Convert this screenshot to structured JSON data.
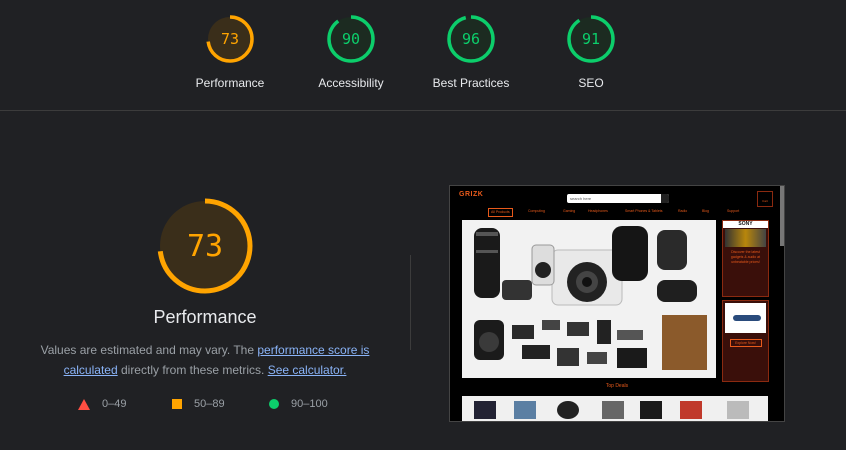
{
  "gauges": [
    {
      "label": "Performance",
      "score": "73",
      "value": 73,
      "color": "#ffa400",
      "bg": "#3a2e1a"
    },
    {
      "label": "Accessibility",
      "score": "90",
      "value": 90,
      "color": "#0cce6b",
      "bg": "#1c2b21"
    },
    {
      "label": "Best Practices",
      "score": "96",
      "value": 96,
      "color": "#0cce6b",
      "bg": "#1c2b21"
    },
    {
      "label": "SEO",
      "score": "91",
      "value": 91,
      "color": "#0cce6b",
      "bg": "#1c2b21"
    }
  ],
  "main": {
    "score": "73",
    "value": 73,
    "title": "Performance",
    "desc_part1": "Values are estimated and may vary. The ",
    "desc_link1": "performance score is calculated",
    "desc_part2": " directly from these metrics. ",
    "desc_link2": "See calculator."
  },
  "legend": {
    "fail": "0–49",
    "average": "50–89",
    "pass": "90–100"
  },
  "thumbnail": {
    "logo": "GRIZK",
    "search_placeholder": "search here",
    "cart": "Cart",
    "categories": [
      "All Products",
      "Computing",
      "Gaming",
      "Headphones",
      "Smart Phones & Tablets",
      "Radio",
      "Blog",
      "Support"
    ],
    "side_brand": "SONY",
    "side_text": "Discover the latest gadgets & audio at unbeatable prices!",
    "side_button": "Explore Now!",
    "deals": "Top Deals"
  },
  "colors": {
    "accent": "#e85a1b",
    "average": "#ffa400",
    "pass": "#0cce6b",
    "fail": "#ff4e42",
    "link": "#8ab4f8"
  }
}
